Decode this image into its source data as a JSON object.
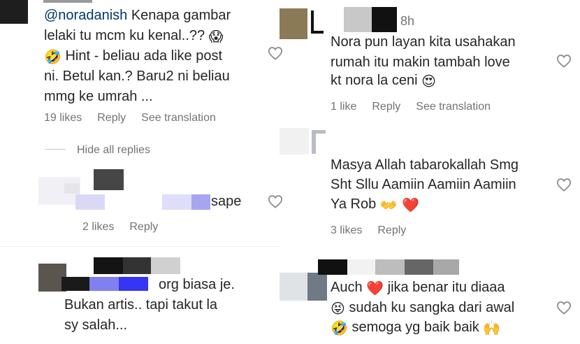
{
  "left_column": {
    "comment_1": {
      "mention": "@noradanish",
      "line1_rest": " Kenapa gambar",
      "line2": "lelaki tu mcm ku kenal..?? ",
      "line2_emoji": "😱",
      "line3_emoji": "🤣",
      "line3": " Hint - beliau ada like post",
      "line4": "ni. Betul kan.? Baru2 ni beliau",
      "line5": "mmg ke umrah ...",
      "likes": "19 likes",
      "reply": "Reply",
      "see_translation": "See translation"
    },
    "hide_replies": "Hide all replies",
    "reply_1": {
      "text": "sape",
      "likes": "2 likes",
      "reply": "Reply"
    },
    "comment_2": {
      "line1": "org biasa je.",
      "line2": "Bukan artis.. tapi takut la",
      "line3": "sy salah..."
    }
  },
  "right_column": {
    "comment_1": {
      "time": "8h",
      "line1": "Nora pun layan kita usahakan",
      "line2": "rumah itu makin tambah love",
      "line3": "kt nora la ceni ",
      "line3_emoji": "😍",
      "likes": "1 like",
      "reply": "Reply",
      "see_translation": "See translation"
    },
    "comment_2": {
      "line1": "Masya Allah tabarokallah Smg",
      "line2": "Sht Sllu Aamiin Aamiin Aamiin",
      "line3": "Ya Rob ",
      "line3_emoji": "👐 ❤️",
      "likes": "3 likes",
      "reply": "Reply"
    },
    "comment_3": {
      "line1": "Auch ",
      "line1_emoji": "❤️",
      "line1_rest": " jika benar itu diaaa",
      "line2_emoji": "😝",
      "line2": " sudah ku sangka dari awal",
      "line3_emoji": "🤣",
      "line3": " semoga yg baik baik ",
      "line3_emoji_end": "🙌"
    }
  },
  "icons": {
    "like": "heart-outline-icon"
  },
  "colors": {
    "text": "#262626",
    "meta": "#737373",
    "mention": "#00376b"
  }
}
